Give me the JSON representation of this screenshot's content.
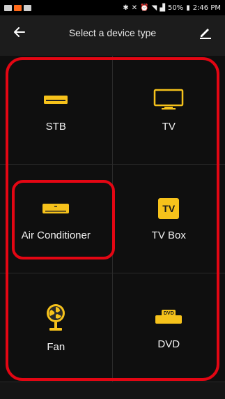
{
  "status_bar": {
    "icons_left": [
      "image-icon",
      "app-notification-icon",
      "folder-icon"
    ],
    "battery_percent": "50%",
    "time": "2:46 PM"
  },
  "header": {
    "title": "Select a device type"
  },
  "devices": [
    {
      "label": "STB",
      "icon": "stb-icon"
    },
    {
      "label": "TV",
      "icon": "tv-icon"
    },
    {
      "label": "Air Conditioner",
      "icon": "air-conditioner-icon"
    },
    {
      "label": "TV Box",
      "icon": "tv-box-icon",
      "icon_text": "TV"
    },
    {
      "label": "Fan",
      "icon": "fan-icon"
    },
    {
      "label": "DVD",
      "icon": "dvd-icon",
      "icon_text": "DVD"
    }
  ],
  "colors": {
    "accent": "#f6c21b",
    "highlight": "#e30613",
    "background": "#1c1c1c",
    "tile": "#0f0f0f"
  }
}
